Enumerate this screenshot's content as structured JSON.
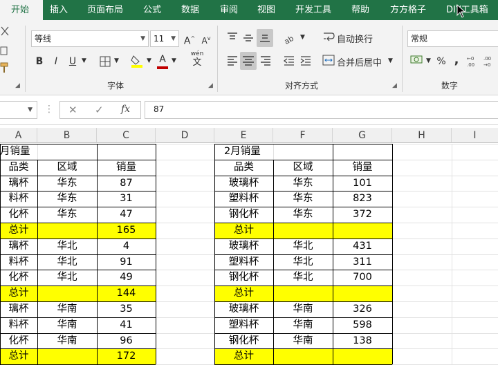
{
  "ribbon_tabs": [
    "开始",
    "插入",
    "页面布局",
    "公式",
    "数据",
    "审阅",
    "视图",
    "开发工具",
    "帮助",
    "方方格子",
    "DIY工具箱"
  ],
  "ribbon": {
    "font_name": "等线",
    "font_size": "11",
    "grow_font": "A",
    "shrink_font": "A",
    "bold": "B",
    "italic": "I",
    "underline": "U",
    "font_color_letter": "A",
    "phonetic_top": "wén",
    "phonetic_bottom": "文",
    "group_font": "字体",
    "group_alignment": "对齐方式",
    "group_number": "数字",
    "wrap_text": "自动换行",
    "merge_center": "合并后居中",
    "number_format": "常规",
    "percent": "%",
    "comma": ","
  },
  "formula_bar": {
    "cancel": "✕",
    "enter": "✓",
    "fx": "fx",
    "value": "87"
  },
  "columns": [
    "A",
    "B",
    "C",
    "D",
    "E",
    "F",
    "G",
    "H",
    "I"
  ],
  "left_table": {
    "title": "月销量",
    "headers": [
      "品类",
      "区域",
      "销量"
    ],
    "rows": [
      [
        "璃杯",
        "华东",
        "87"
      ],
      [
        "料杯",
        "华东",
        "31"
      ],
      [
        "化杯",
        "华东",
        "47"
      ],
      [
        "总计",
        "",
        "165"
      ],
      [
        "璃杯",
        "华北",
        "4"
      ],
      [
        "料杯",
        "华北",
        "91"
      ],
      [
        "化杯",
        "华北",
        "49"
      ],
      [
        "总计",
        "",
        "144"
      ],
      [
        "璃杯",
        "华南",
        "35"
      ],
      [
        "料杯",
        "华南",
        "41"
      ],
      [
        "化杯",
        "华南",
        "96"
      ],
      [
        "总计",
        "",
        "172"
      ]
    ]
  },
  "right_table": {
    "title": "2月销量",
    "headers": [
      "品类",
      "区域",
      "销量"
    ],
    "rows": [
      [
        "玻璃杯",
        "华东",
        "101"
      ],
      [
        "塑料杯",
        "华东",
        "823"
      ],
      [
        "钢化杯",
        "华东",
        "372"
      ],
      [
        "总计",
        "",
        ""
      ],
      [
        "玻璃杯",
        "华北",
        "431"
      ],
      [
        "塑料杯",
        "华北",
        "311"
      ],
      [
        "钢化杯",
        "华北",
        "700"
      ],
      [
        "总计",
        "",
        ""
      ],
      [
        "玻璃杯",
        "华南",
        "326"
      ],
      [
        "塑料杯",
        "华南",
        "598"
      ],
      [
        "钢化杯",
        "华南",
        "138"
      ],
      [
        "总计",
        "",
        ""
      ]
    ]
  },
  "colors": {
    "ribbon_green": "#217346",
    "total_fill": "#ffff00",
    "font_color_bar": "#c00000",
    "highlight_bar": "#ffff00"
  }
}
